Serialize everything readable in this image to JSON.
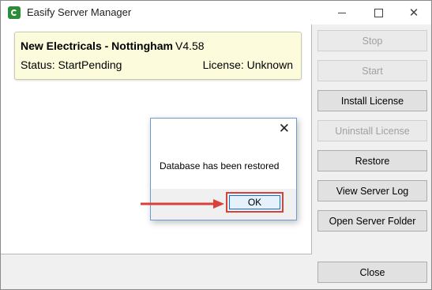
{
  "window": {
    "title": "Easify Server Manager",
    "controls": {
      "minimize": "minimize",
      "maximize": "maximize",
      "close": "✕"
    }
  },
  "server_card": {
    "name": "New Electricals - Nottingham",
    "version": "V4.58",
    "status": "Status: StartPending",
    "license": "License: Unknown",
    "background": "#fcfbdc"
  },
  "side_buttons": [
    {
      "label": "Stop",
      "enabled": false
    },
    {
      "label": "Start",
      "enabled": false
    },
    {
      "label": "Install License",
      "enabled": true
    },
    {
      "label": "Uninstall License",
      "enabled": false
    },
    {
      "label": "Restore",
      "enabled": true
    },
    {
      "label": "View Server Log",
      "enabled": true
    },
    {
      "label": "Open Server Folder",
      "enabled": true
    },
    {
      "label": "Close",
      "enabled": true
    }
  ],
  "dialog": {
    "message": "Database has been restored",
    "ok_label": "OK",
    "close_glyph": "✕"
  },
  "colors": {
    "annotation": "#d9403a",
    "ok_button_border": "#0078d7"
  }
}
